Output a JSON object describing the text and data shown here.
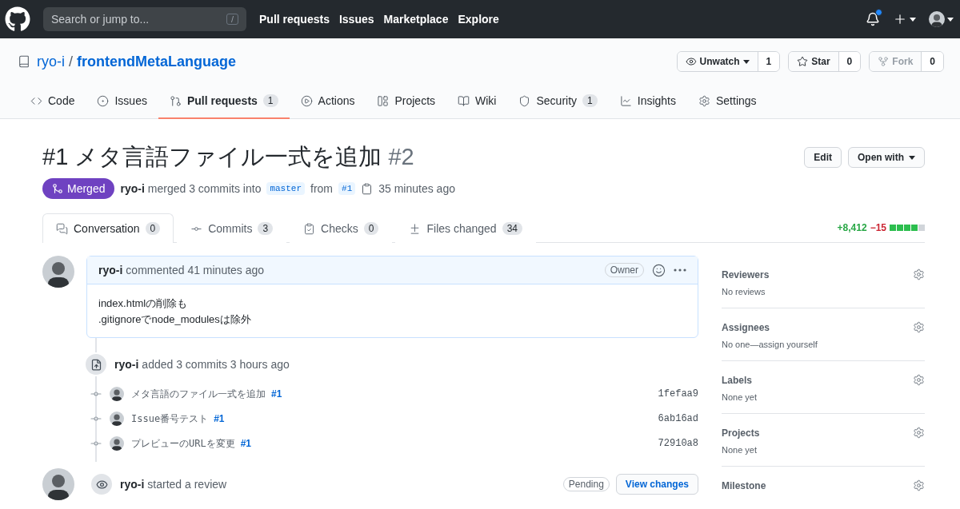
{
  "header": {
    "search_placeholder": "Search or jump to...",
    "search_key": "/",
    "links": [
      "Pull requests",
      "Issues",
      "Marketplace",
      "Explore"
    ],
    "notification_unread": true
  },
  "repo": {
    "owner": "ryo-i",
    "separator": "/",
    "name": "frontendMetaLanguage",
    "actions": [
      {
        "kind": "watch",
        "label": "Unwatch",
        "count": "1",
        "disabled": false
      },
      {
        "kind": "star",
        "label": "Star",
        "count": "0",
        "disabled": false
      },
      {
        "kind": "fork",
        "label": "Fork",
        "count": "0",
        "disabled": true
      }
    ]
  },
  "nav": [
    {
      "label": "Code",
      "selected": false
    },
    {
      "label": "Issues",
      "selected": false
    },
    {
      "label": "Pull requests",
      "count": "1",
      "selected": true
    },
    {
      "label": "Actions",
      "selected": false
    },
    {
      "label": "Projects",
      "selected": false
    },
    {
      "label": "Wiki",
      "selected": false
    },
    {
      "label": "Security",
      "count": "1",
      "selected": false
    },
    {
      "label": "Insights",
      "selected": false
    },
    {
      "label": "Settings",
      "selected": false
    }
  ],
  "pr": {
    "title": "#1 メタ言語ファイル一式を追加",
    "number": "#2",
    "buttons": [
      "Edit",
      "Open with"
    ],
    "state": "Merged",
    "author": "ryo-i",
    "merge_text": "merged 3 commits into",
    "base": "master",
    "from_text": "from",
    "head": "#1",
    "time": "35 minutes ago",
    "tabs": [
      {
        "label": "Conversation",
        "count": "0",
        "selected": true
      },
      {
        "label": "Commits",
        "count": "3",
        "selected": false
      },
      {
        "label": "Checks",
        "count": "0",
        "selected": false
      },
      {
        "label": "Files changed",
        "count": "34",
        "selected": false
      }
    ],
    "additions": "+8,412",
    "deletions": "−15",
    "diff_bar": {
      "level": 0.8
    }
  },
  "timeline": [
    {
      "kind": "comment",
      "author": "ryo-i",
      "text": "commented 41 minutes ago",
      "badge": "Owner",
      "body": [
        "index.htmlの削除も",
        ".gitignoreでnode_modulesは除外"
      ]
    },
    {
      "kind": "commits",
      "author": "ryo-i",
      "text": "added 3 commits 3 hours ago",
      "commits": [
        {
          "message": "メタ言語のファイル一式を追加",
          "ref": "#1",
          "sha": "1fefaa9"
        },
        {
          "message": "Issue番号テスト",
          "ref": "#1",
          "sha": "6ab16ad"
        },
        {
          "message": "プレビューのURLを変更",
          "ref": "#1",
          "sha": "72910a8"
        }
      ]
    },
    {
      "kind": "review",
      "author": "ryo-i",
      "text": "started a review",
      "badge": "Pending",
      "button": "View changes"
    }
  ],
  "sidebar": [
    {
      "title": "Reviewers",
      "value": "No reviews"
    },
    {
      "title": "Assignees",
      "value": "No one—assign yourself"
    },
    {
      "title": "Labels",
      "value": "None yet"
    },
    {
      "title": "Projects",
      "value": "None yet"
    },
    {
      "title": "Milestone"
    }
  ]
}
